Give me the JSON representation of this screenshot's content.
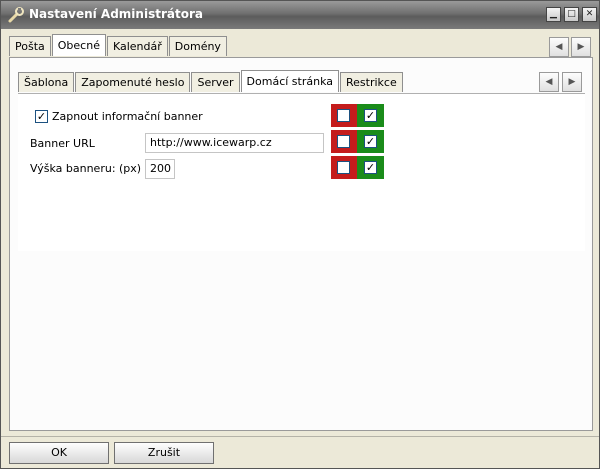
{
  "window": {
    "title": "Nastavení Administrátora"
  },
  "outer_tabs": [
    {
      "label": "Pošta",
      "active": false
    },
    {
      "label": "Obecné",
      "active": true
    },
    {
      "label": "Kalendář",
      "active": false
    },
    {
      "label": "Domény",
      "active": false
    }
  ],
  "inner_tabs": [
    {
      "label": "Šablona",
      "active": false
    },
    {
      "label": "Zapomenuté heslo",
      "active": false
    },
    {
      "label": "Server",
      "active": false
    },
    {
      "label": "Domácí stránka",
      "active": true
    },
    {
      "label": "Restrikce",
      "active": false
    }
  ],
  "form": {
    "enable_banner": {
      "label": "Zapnout informační banner",
      "checked": true
    },
    "banner_url": {
      "label": "Banner URL",
      "value": "http://www.icewarp.cz"
    },
    "banner_height": {
      "label": "Výška banneru: (px)",
      "value": "200"
    }
  },
  "flags": [
    {
      "deny": false,
      "allow": true
    },
    {
      "deny": false,
      "allow": true
    },
    {
      "deny": false,
      "allow": true
    }
  ],
  "buttons": {
    "ok": "OK",
    "cancel": "Zrušit"
  },
  "colors": {
    "deny": "#c41c1c",
    "allow": "#1a8c1a",
    "titlebar": "#6f6f6f"
  }
}
